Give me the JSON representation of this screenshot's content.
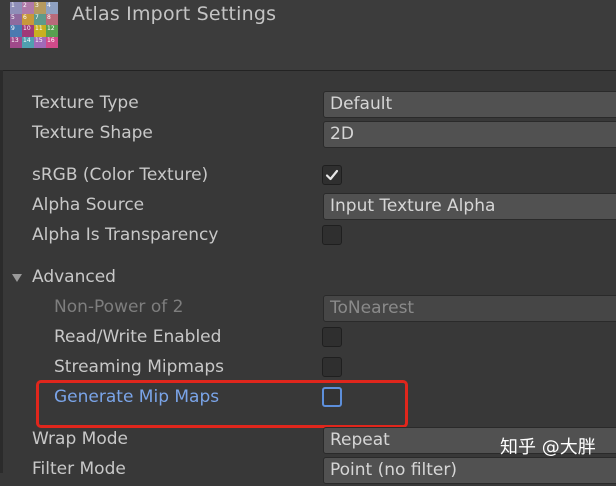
{
  "window": {
    "title": "Atlas Import Settings"
  },
  "atlas_icon": {
    "cells": [
      {
        "n": "1",
        "color": "#8f8fb8"
      },
      {
        "n": "2",
        "color": "#b07aa8"
      },
      {
        "n": "3",
        "color": "#b59a5e"
      },
      {
        "n": "4",
        "color": "#8ea0c0"
      },
      {
        "n": "5",
        "color": "#8f6a9e"
      },
      {
        "n": "6",
        "color": "#c8983a"
      },
      {
        "n": "7",
        "color": "#5e9a8a"
      },
      {
        "n": "8",
        "color": "#b86a7a"
      },
      {
        "n": "9",
        "color": "#4a7ab0"
      },
      {
        "n": "10",
        "color": "#a03a78"
      },
      {
        "n": "11",
        "color": "#c8b020"
      },
      {
        "n": "12",
        "color": "#58a050"
      },
      {
        "n": "13",
        "color": "#a04a8a"
      },
      {
        "n": "14",
        "color": "#50a0b0"
      },
      {
        "n": "15",
        "color": "#a06ab8"
      },
      {
        "n": "16",
        "color": "#d04a8a"
      }
    ]
  },
  "settings": {
    "texture_type": {
      "label": "Texture Type",
      "value": "Default"
    },
    "texture_shape": {
      "label": "Texture Shape",
      "value": "2D"
    },
    "srgb": {
      "label": "sRGB (Color Texture)",
      "checked": true
    },
    "alpha_source": {
      "label": "Alpha Source",
      "value": "Input Texture Alpha"
    },
    "alpha_is_transparency": {
      "label": "Alpha Is Transparency",
      "checked": false
    },
    "advanced": {
      "label": "Advanced",
      "expanded": true
    },
    "non_power_of_2": {
      "label": "Non-Power of 2",
      "value": "ToNearest",
      "disabled": true
    },
    "read_write": {
      "label": "Read/Write Enabled",
      "checked": false
    },
    "streaming_mipmaps": {
      "label": "Streaming Mipmaps",
      "checked": false
    },
    "generate_mip_maps": {
      "label": "Generate Mip Maps",
      "checked": false
    },
    "wrap_mode": {
      "label": "Wrap Mode",
      "value": "Repeat"
    },
    "filter_mode": {
      "label": "Filter Mode",
      "value": "Point (no filter)"
    }
  },
  "watermark": {
    "text": "知乎 @大胖"
  },
  "colors": {
    "highlight_red": "#e0261c",
    "accent_blue": "#7aa4e8"
  }
}
